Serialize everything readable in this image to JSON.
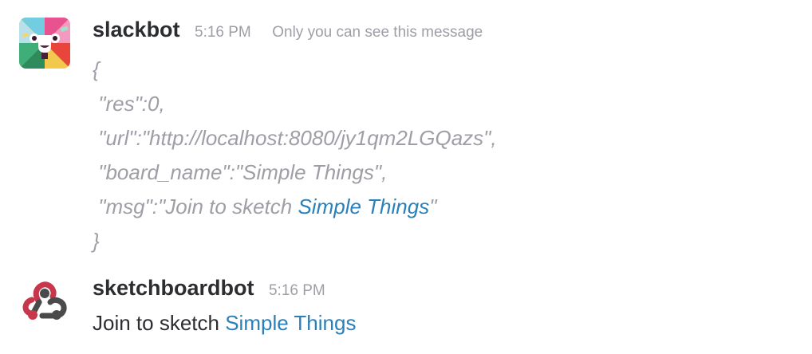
{
  "messages": [
    {
      "username": "slackbot",
      "time": "5:16 PM",
      "visibility_note": "Only you can see this message",
      "avatar_icon": "slackbot-avatar-icon",
      "json_open": "{",
      "json_close": "}",
      "fields": {
        "res": " \"res\":0,",
        "url": " \"url\":\"http://localhost:8080/jy1qm2LGQazs\",",
        "board_name": " \"board_name\":\"Simple Things\",",
        "msg_prefix": " \"msg\":\"Join to sketch ",
        "msg_link": "Simple Things",
        "msg_suffix": "\""
      }
    },
    {
      "username": "sketchboardbot",
      "time": "5:16 PM",
      "avatar_icon": "webhook-icon",
      "text_prefix": "Join to sketch ",
      "text_link": "Simple Things"
    }
  ],
  "colors": {
    "link": "#2a80b9",
    "muted": "#9e9ea6",
    "text": "#2c2d30"
  }
}
